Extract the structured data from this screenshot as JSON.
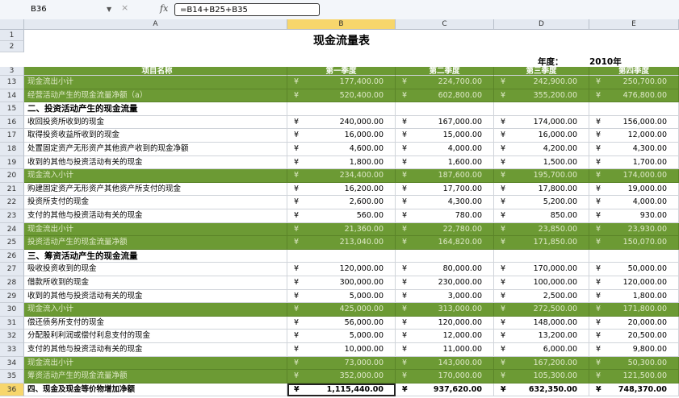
{
  "formula_bar": {
    "name_box": "B36",
    "formula": "=B14+B25+B35",
    "fx_label": "fx",
    "cancel_label": "×"
  },
  "columns": [
    "A",
    "B",
    "C",
    "D",
    "E"
  ],
  "title": "现金流量表",
  "year_label": "年度：",
  "year_value": "2010年",
  "header": {
    "row": "3",
    "name": "项目名称",
    "q1": "第一季度",
    "q2": "第二季度",
    "q3": "第三季度",
    "q4": "第四季度"
  },
  "currency": "¥",
  "rows": [
    {
      "n": "13",
      "a": "现金流出小计",
      "b": "177,400.00",
      "c": "224,700.00",
      "d": "242,900.00",
      "e": "250,700.00",
      "style": "green"
    },
    {
      "n": "14",
      "a": "经营活动产生的现金流量净额（a）",
      "b": "520,400.00",
      "c": "602,800.00",
      "d": "355,200.00",
      "e": "476,800.00",
      "style": "green"
    },
    {
      "n": "15",
      "a": "二、投资活动产生的现金流量",
      "b": "",
      "c": "",
      "d": "",
      "e": "",
      "style": "sec"
    },
    {
      "n": "16",
      "a": "收回投资所收到的现金",
      "b": "240,000.00",
      "c": "167,000.00",
      "d": "174,000.00",
      "e": "156,000.00",
      "style": ""
    },
    {
      "n": "17",
      "a": "取得投资收益所收到的现金",
      "b": "16,000.00",
      "c": "15,000.00",
      "d": "16,000.00",
      "e": "12,000.00",
      "style": ""
    },
    {
      "n": "18",
      "a": "处置固定资产无形资产其他资产收到的现金净额",
      "b": "4,600.00",
      "c": "4,000.00",
      "d": "4,200.00",
      "e": "4,300.00",
      "style": ""
    },
    {
      "n": "19",
      "a": "收到的其他与投资活动有关的现金",
      "b": "1,800.00",
      "c": "1,600.00",
      "d": "1,500.00",
      "e": "1,700.00",
      "style": ""
    },
    {
      "n": "20",
      "a": "现金流入小计",
      "b": "234,400.00",
      "c": "187,600.00",
      "d": "195,700.00",
      "e": "174,000.00",
      "style": "green"
    },
    {
      "n": "21",
      "a": "购建固定资产无形资产其他资产所支付的现金",
      "b": "16,200.00",
      "c": "17,700.00",
      "d": "17,800.00",
      "e": "19,000.00",
      "style": ""
    },
    {
      "n": "22",
      "a": "投资所支付的现金",
      "b": "2,600.00",
      "c": "4,300.00",
      "d": "5,200.00",
      "e": "4,000.00",
      "style": ""
    },
    {
      "n": "23",
      "a": "支付的其他与投资活动有关的现金",
      "b": "560.00",
      "c": "780.00",
      "d": "850.00",
      "e": "930.00",
      "style": ""
    },
    {
      "n": "24",
      "a": "现金流出小计",
      "b": "21,360.00",
      "c": "22,780.00",
      "d": "23,850.00",
      "e": "23,930.00",
      "style": "green"
    },
    {
      "n": "25",
      "a": "投资活动产生的现金流量净额",
      "b": "213,040.00",
      "c": "164,820.00",
      "d": "171,850.00",
      "e": "150,070.00",
      "style": "green"
    },
    {
      "n": "26",
      "a": "三、筹资活动产生的现金流量",
      "b": "",
      "c": "",
      "d": "",
      "e": "",
      "style": "sec"
    },
    {
      "n": "27",
      "a": "吸收投资收到的现金",
      "b": "120,000.00",
      "c": "80,000.00",
      "d": "170,000.00",
      "e": "50,000.00",
      "style": ""
    },
    {
      "n": "28",
      "a": "借款所收到的现金",
      "b": "300,000.00",
      "c": "230,000.00",
      "d": "100,000.00",
      "e": "120,000.00",
      "style": ""
    },
    {
      "n": "29",
      "a": "收到的其他与投资活动有关的现金",
      "b": "5,000.00",
      "c": "3,000.00",
      "d": "2,500.00",
      "e": "1,800.00",
      "style": ""
    },
    {
      "n": "30",
      "a": "现金流入小计",
      "b": "425,000.00",
      "c": "313,000.00",
      "d": "272,500.00",
      "e": "171,800.00",
      "style": "green"
    },
    {
      "n": "31",
      "a": "偿还债务所支付的现金",
      "b": "56,000.00",
      "c": "120,000.00",
      "d": "148,000.00",
      "e": "20,000.00",
      "style": ""
    },
    {
      "n": "32",
      "a": "分配股利利润或偿付利息支付的现金",
      "b": "5,000.00",
      "c": "12,000.00",
      "d": "13,200.00",
      "e": "20,500.00",
      "style": ""
    },
    {
      "n": "33",
      "a": "支付的其他与投资活动有关的现金",
      "b": "10,000.00",
      "c": "11,000.00",
      "d": "6,000.00",
      "e": "9,800.00",
      "style": ""
    },
    {
      "n": "34",
      "a": "现金流出小计",
      "b": "73,000.00",
      "c": "143,000.00",
      "d": "167,200.00",
      "e": "50,300.00",
      "style": "green"
    },
    {
      "n": "35",
      "a": "筹资活动产生的现金流量净额",
      "b": "352,000.00",
      "c": "170,000.00",
      "d": "105,300.00",
      "e": "121,500.00",
      "style": "green"
    },
    {
      "n": "36",
      "a": "四、现金及现金等价物增加净额",
      "b": "1,115,440.00",
      "c": "937,620.00",
      "d": "632,350.00",
      "e": "748,370.00",
      "style": "tot"
    }
  ]
}
